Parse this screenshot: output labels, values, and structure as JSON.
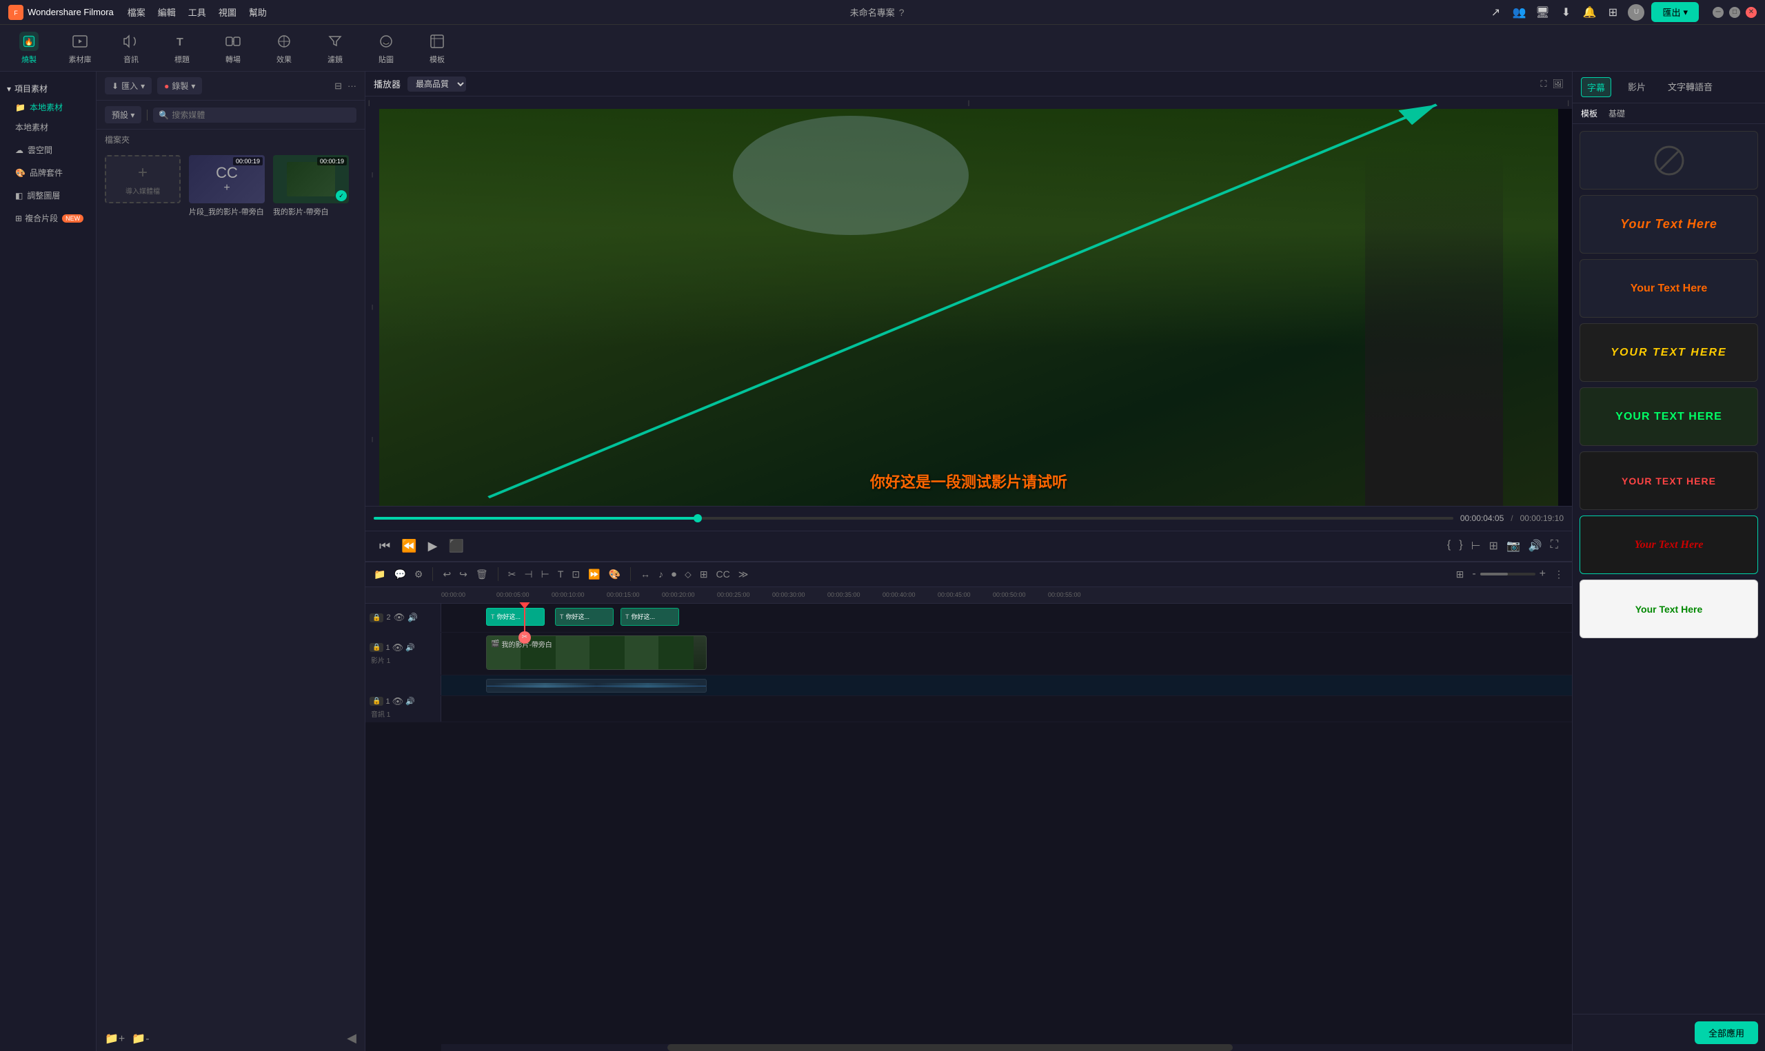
{
  "app": {
    "name": "Wondershare Filmora",
    "title_untitled": "未命名專案",
    "export_label": "匯出"
  },
  "menu": {
    "file": "檔案",
    "edit": "編輯",
    "tools": "工具",
    "view": "視圖",
    "help": "幫助"
  },
  "toolbar": {
    "burn_label": "燒製",
    "media_label": "素材庫",
    "audio_label": "音訊",
    "title_label": "標題",
    "transition_label": "轉場",
    "effect_label": "效果",
    "filter_label": "濾鏡",
    "sticker_label": "貼圖",
    "template_label": "模板"
  },
  "left_panel": {
    "project_assets": "項目素材",
    "local_media": "本地素材",
    "cloud_space": "雲空間",
    "brand_kit": "品牌套件",
    "blend_layer": "調整圖層",
    "composite": "複合片段"
  },
  "media_panel": {
    "import_label": "匯入",
    "record_label": "錄製",
    "preset_label": "預設",
    "search_placeholder": "搜索媒體",
    "folder_label": "檔案夾",
    "import_media_label": "導入媒體檔",
    "media_1_name": "片段_我的影片-帶旁白",
    "media_2_name": "我的影片-帶旁白"
  },
  "preview": {
    "player_label": "播放器",
    "quality_label": "最高品質",
    "time_current": "00:00:04:05",
    "time_separator": "/",
    "time_total": "00:00:19:10",
    "subtitle": "你好这是一段测试影片请试听"
  },
  "right_panel": {
    "titles_tab": "字幕",
    "films_tab": "影片",
    "speech_tab": "文字轉語音",
    "templates_subtab": "模板",
    "basics_subtab": "基礎",
    "apply_all_label": "全部應用"
  },
  "title_templates": [
    {
      "id": "t0",
      "style": "no-template",
      "text": "",
      "label": ""
    },
    {
      "id": "t1",
      "style": "style1",
      "main": "Your Text ",
      "accent": "Here",
      "label": "Your Text Here"
    },
    {
      "id": "t2",
      "style": "style2",
      "main": "Your Text ",
      "accent": "Here",
      "label": "Your Text Here"
    },
    {
      "id": "t3",
      "style": "style3",
      "main": "YOUR TEXT HERE",
      "accent": "",
      "label": "YOUR TEXT HERE"
    },
    {
      "id": "t4",
      "style": "style4",
      "main": "YOUR Text ",
      "accent": "HeRe",
      "label": "YOUR Text HeRe"
    },
    {
      "id": "t5",
      "style": "style5",
      "main": "YOUR Text ",
      "accent": "Here",
      "label": "YOUR Text Here"
    },
    {
      "id": "t6",
      "style": "style6",
      "main": "Your Text ",
      "accent": "Here",
      "label": "Your Text Here"
    },
    {
      "id": "t7",
      "style": "style7",
      "main": "Your Text ",
      "accent": "Here",
      "label": "Your Text Here"
    }
  ],
  "timeline": {
    "tracks": [
      {
        "id": "track2",
        "type": "subtitle",
        "icon": "T",
        "name": "",
        "number": "2"
      },
      {
        "id": "track1",
        "type": "video",
        "icon": "🎬",
        "name": "影片 1",
        "number": "1"
      },
      {
        "id": "audio1",
        "type": "audio",
        "icon": "♪",
        "name": "音訊 1",
        "number": "1"
      }
    ],
    "time_markers": [
      "00:00:00",
      "00:00:05:00",
      "00:00:10:00",
      "00:00:15:00",
      "00:00:20:00",
      "00:00:25:00",
      "00:00:30:00",
      "00:00:35:00",
      "00:00:40:00",
      "00:00:45:00",
      "00:00:50:00",
      "00:00:55:00"
    ],
    "subtitle_clips": [
      "你好这...",
      "你好这...",
      "你好这..."
    ],
    "video_clip_label": "我的影片-帶旁白"
  }
}
